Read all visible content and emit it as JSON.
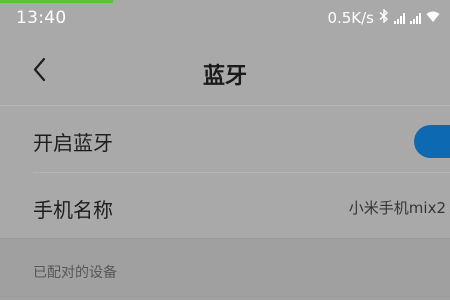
{
  "status_bar": {
    "time": "13:40",
    "network_speed": "0.5K/s",
    "icons": [
      "bluetooth-icon",
      "signal-icon",
      "signal-icon",
      "wifi-icon"
    ],
    "progress": 0.25,
    "progress_color": "#5cbf3a"
  },
  "nav": {
    "back_icon": "chevron-left-icon",
    "title": "蓝牙"
  },
  "rows": [
    {
      "label": "开启蓝牙",
      "toggle_on": true,
      "toggle_color": "#0e69b3"
    },
    {
      "label": "手机名称",
      "value": "小米手机mix2"
    }
  ],
  "paired_section": {
    "header": "已配对的设备"
  }
}
